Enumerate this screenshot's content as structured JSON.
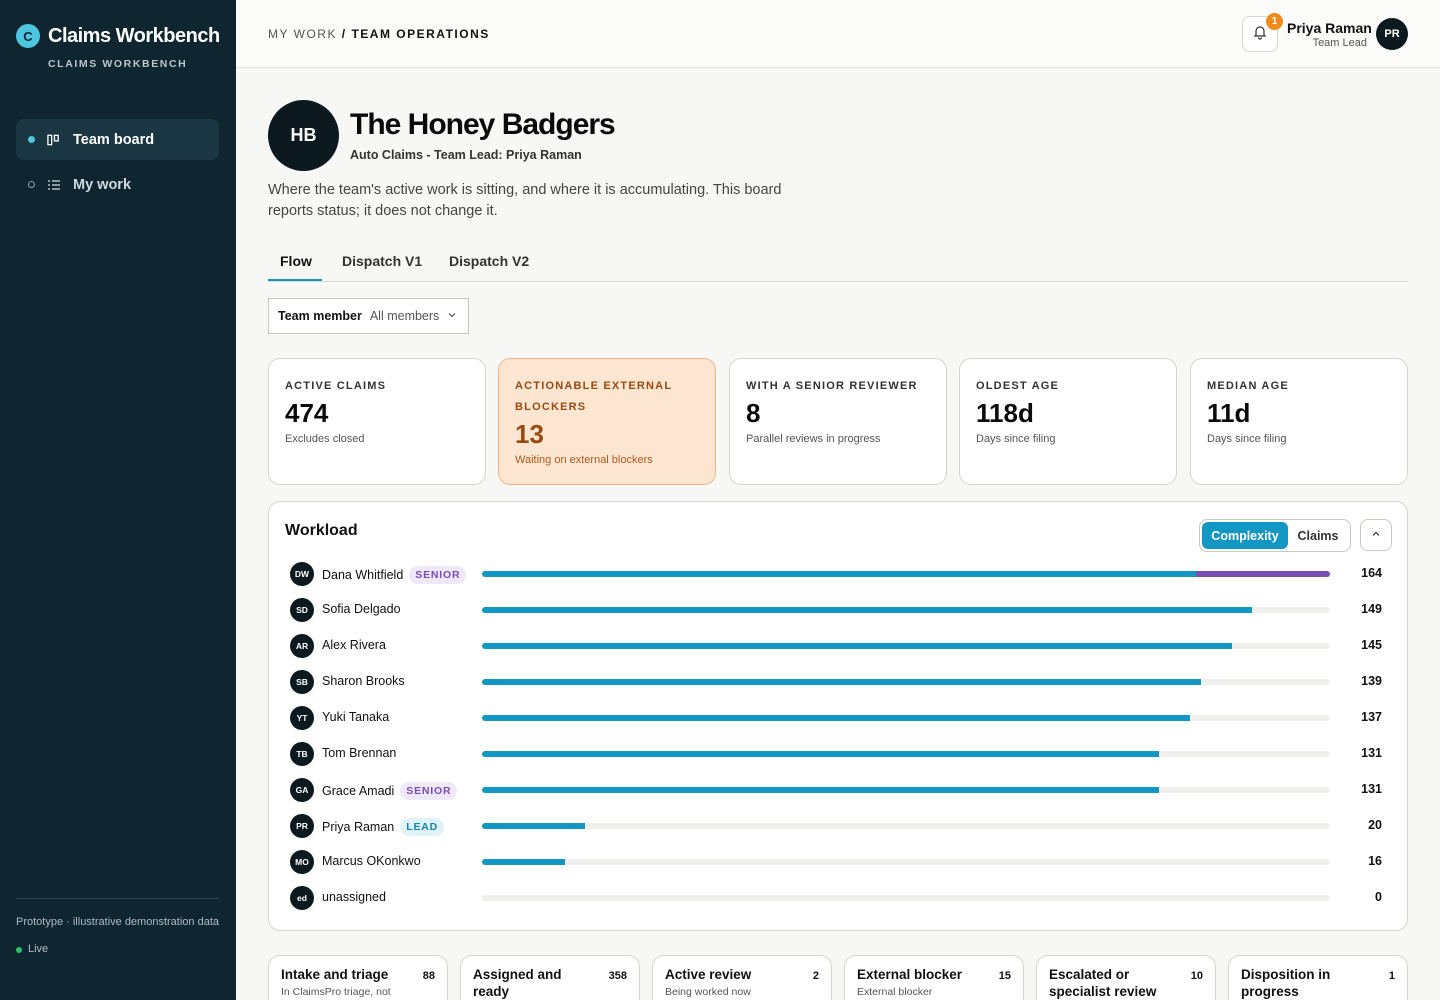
{
  "app": {
    "logo_letter": "C",
    "name": "Claims Workbench",
    "subtitle": "CLAIMS WORKBENCH"
  },
  "nav": {
    "items": [
      {
        "label": "Team board",
        "icon": "board-icon",
        "active": true
      },
      {
        "label": "My work",
        "icon": "list-icon",
        "active": false
      }
    ]
  },
  "sidebar_footer": {
    "note": "Prototype · illustrative demonstration data",
    "status": "Live"
  },
  "header": {
    "breadcrumb_root": "MY WORK",
    "breadcrumb_sep": " / ",
    "breadcrumb_current": "TEAM OPERATIONS",
    "notification_count": "1",
    "user_name": "Priya Raman",
    "user_role": "Team Lead",
    "user_initials": "PR"
  },
  "team": {
    "initials": "HB",
    "title": "The Honey Badgers",
    "subtitle": "Auto Claims - Team Lead: Priya Raman",
    "description": "Where the team's active work is sitting, and where it is accumulating. This board reports status; it does not change it."
  },
  "tabs": [
    {
      "label": "Flow",
      "active": true
    },
    {
      "label": "Dispatch V1",
      "active": false
    },
    {
      "label": "Dispatch V2",
      "active": false
    }
  ],
  "filter": {
    "label": "Team member",
    "value": "All members"
  },
  "stats": [
    {
      "label": "ACTIVE CLAIMS",
      "value": "474",
      "note": "Excludes closed",
      "warn": false
    },
    {
      "label": "ACTIONABLE EXTERNAL BLOCKERS",
      "value": "13",
      "note": "Waiting on external blockers",
      "warn": true
    },
    {
      "label": "WITH A SENIOR REVIEWER",
      "value": "8",
      "note": "Parallel reviews in progress",
      "warn": false
    },
    {
      "label": "OLDEST AGE",
      "value": "118d",
      "note": "Days since filing",
      "warn": false
    },
    {
      "label": "MEDIAN AGE",
      "value": "11d",
      "note": "Days since filing",
      "warn": false
    }
  ],
  "workload": {
    "title": "Workload",
    "toggle_on": "Complexity",
    "toggle_off": "Claims",
    "max": 164,
    "rows": [
      {
        "initials": "DW",
        "name": "Dana Whitfield",
        "tag": "SENIOR",
        "tag_type": "senior",
        "value": 164,
        "count": "164",
        "senior_share": 0.158
      },
      {
        "initials": "SD",
        "name": "Sofia Delgado",
        "tag": "",
        "tag_type": "",
        "value": 149,
        "count": "149",
        "senior_share": 0
      },
      {
        "initials": "AR",
        "name": "Alex Rivera",
        "tag": "",
        "tag_type": "",
        "value": 145,
        "count": "145",
        "senior_share": 0
      },
      {
        "initials": "SB",
        "name": "Sharon Brooks",
        "tag": "",
        "tag_type": "",
        "value": 139,
        "count": "139",
        "senior_share": 0
      },
      {
        "initials": "YT",
        "name": "Yuki Tanaka",
        "tag": "",
        "tag_type": "",
        "value": 137,
        "count": "137",
        "senior_share": 0
      },
      {
        "initials": "TB",
        "name": "Tom Brennan",
        "tag": "",
        "tag_type": "",
        "value": 131,
        "count": "131",
        "senior_share": 0
      },
      {
        "initials": "GA",
        "name": "Grace Amadi",
        "tag": "SENIOR",
        "tag_type": "senior",
        "value": 131,
        "count": "131",
        "senior_share": 0
      },
      {
        "initials": "PR",
        "name": "Priya Raman",
        "tag": "LEAD",
        "tag_type": "lead",
        "value": 20,
        "count": "20",
        "senior_share": 0
      },
      {
        "initials": "MO",
        "name": "Marcus OKonkwo",
        "tag": "",
        "tag_type": "",
        "value": 16,
        "count": "16",
        "senior_share": 0
      },
      {
        "initials": "ed",
        "name": "unassigned",
        "tag": "",
        "tag_type": "",
        "value": 0,
        "count": "0",
        "senior_share": 0
      }
    ]
  },
  "stages": [
    {
      "title": "Intake and triage",
      "count": "88",
      "note": "In ClaimsPro triage, not"
    },
    {
      "title": "Assigned and ready",
      "count": "358",
      "note": ""
    },
    {
      "title": "Active review",
      "count": "2",
      "note": "Being worked now"
    },
    {
      "title": "External blocker",
      "count": "15",
      "note": "External blocker"
    },
    {
      "title": "Escalated or specialist review",
      "count": "10",
      "note": ""
    },
    {
      "title": "Disposition in progress",
      "count": "1",
      "note": ""
    }
  ],
  "colors": {
    "sidebar": "#0f2530",
    "accent": "#1296c4",
    "senior": "#7b4fb2",
    "warn_bg": "#fde6d1",
    "warn_text": "#9a4a10",
    "badge": "#f08a1c"
  }
}
